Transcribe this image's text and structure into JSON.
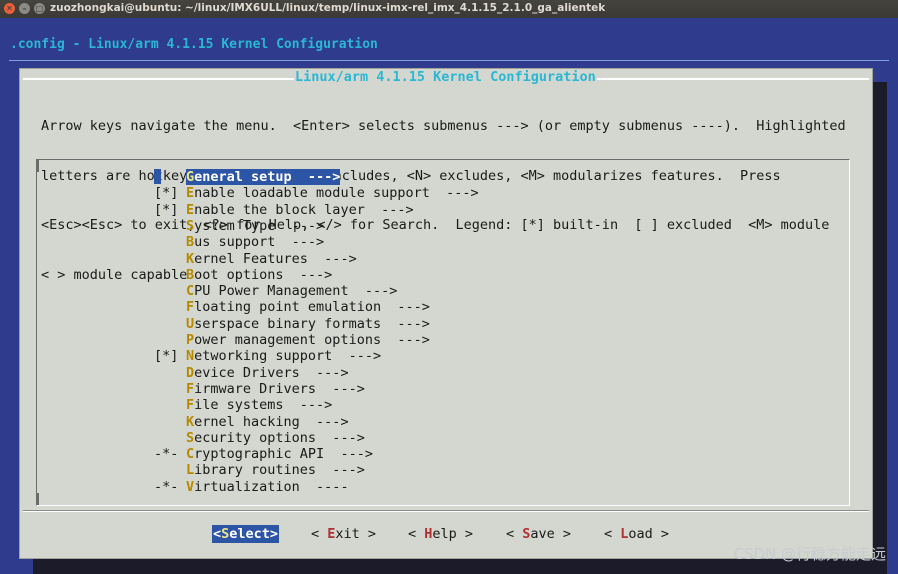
{
  "window": {
    "title": "zuozhongkai@ubuntu: ~/linux/IMX6ULL/linux/temp/linux-imx-rel_imx_4.1.15_2.1.0_ga_alientek"
  },
  "header": {
    "title": ".config - Linux/arm 4.1.15 Kernel Configuration"
  },
  "dialog": {
    "title": "Linux/arm 4.1.15 Kernel Configuration",
    "help_lines": [
      "Arrow keys navigate the menu.  <Enter> selects submenus ---> (or empty submenus ----).  Highlighted",
      "letters are hotkeys.  Pressing <Y> includes, <N> excludes, <M> modularizes features.  Press",
      "<Esc><Esc> to exit, <?> for Help, </> for Search.  Legend: [*] built-in  [ ] excluded  <M> module",
      "< > module capable"
    ]
  },
  "menu": {
    "items": [
      {
        "prefix": "",
        "hotkey": "G",
        "rest": "eneral setup  --->",
        "selected": true
      },
      {
        "prefix": "[*]",
        "hotkey": "E",
        "rest": "nable loadable module support  --->"
      },
      {
        "prefix": "[*]",
        "hotkey": "E",
        "rest": "nable the block layer  --->"
      },
      {
        "prefix": "",
        "hotkey": "S",
        "rest": "ystem Type  --->"
      },
      {
        "prefix": "",
        "hotkey": "B",
        "rest": "us support  --->"
      },
      {
        "prefix": "",
        "hotkey": "K",
        "rest": "ernel Features  --->"
      },
      {
        "prefix": "",
        "hotkey": "B",
        "rest": "oot options  --->"
      },
      {
        "prefix": "",
        "hotkey": "C",
        "rest": "PU Power Management  --->"
      },
      {
        "prefix": "",
        "hotkey": "F",
        "rest": "loating point emulation  --->"
      },
      {
        "prefix": "",
        "hotkey": "U",
        "rest": "serspace binary formats  --->"
      },
      {
        "prefix": "",
        "hotkey": "P",
        "rest": "ower management options  --->"
      },
      {
        "prefix": "[*]",
        "hotkey": "N",
        "rest": "etworking support  --->"
      },
      {
        "prefix": "",
        "hotkey": "D",
        "rest": "evice Drivers  --->"
      },
      {
        "prefix": "",
        "hotkey": "F",
        "rest": "irmware Drivers  --->"
      },
      {
        "prefix": "",
        "hotkey": "F",
        "rest": "ile systems  --->"
      },
      {
        "prefix": "",
        "hotkey": "K",
        "rest": "ernel hacking  --->"
      },
      {
        "prefix": "",
        "hotkey": "S",
        "rest": "ecurity options  --->"
      },
      {
        "prefix": "-*-",
        "hotkey": "C",
        "rest": "ryptographic API  --->"
      },
      {
        "prefix": "",
        "hotkey": "L",
        "rest": "ibrary routines  --->"
      },
      {
        "prefix": "-*-",
        "hotkey": "V",
        "rest": "irtualization  ----"
      }
    ]
  },
  "buttons": [
    {
      "pre": "<",
      "hotkey": "S",
      "rest": "elect>",
      "active": true
    },
    {
      "pre": "< ",
      "hotkey": "E",
      "rest": "xit >",
      "active": false
    },
    {
      "pre": "< ",
      "hotkey": "H",
      "rest": "elp >",
      "active": false
    },
    {
      "pre": "< ",
      "hotkey": "S",
      "rest": "ave >",
      "active": false
    },
    {
      "pre": "< ",
      "hotkey": "L",
      "rest": "oad >",
      "active": false
    }
  ],
  "watermark": "CSDN @行稳方能走远"
}
